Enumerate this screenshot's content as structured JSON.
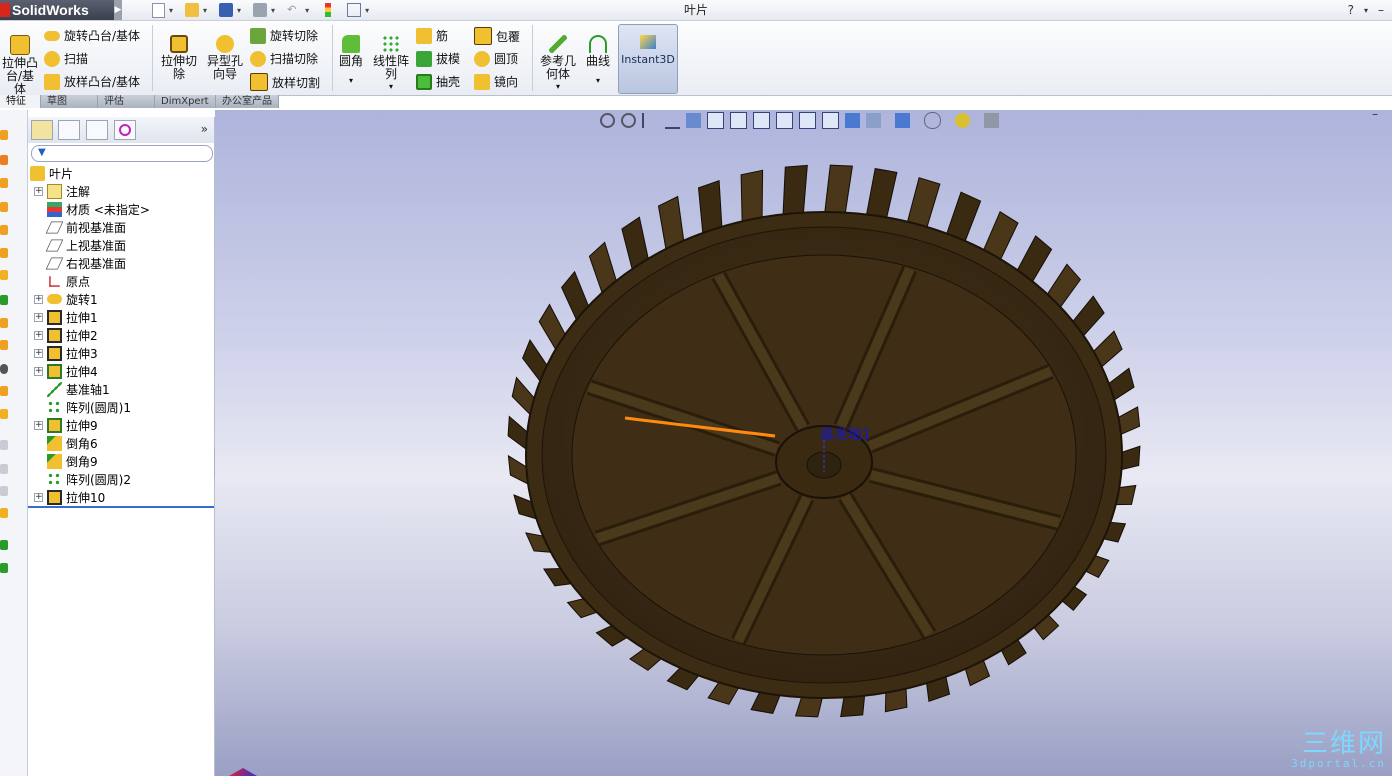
{
  "app": {
    "brand": "SolidWorks",
    "title": "叶片",
    "help": "?",
    "minimize": "–"
  },
  "ribbon": {
    "cmd_extrude_boss": "拉伸凸台/基体",
    "cmd_revolve_boss": "旋转凸台/基体",
    "cmd_sweep": "扫描",
    "cmd_loft_boss": "放样凸台/基体",
    "cmd_extrude_cut": "拉伸切除",
    "cmd_hole_wizard": "异型孔向导",
    "cmd_revolve_cut": "旋转切除",
    "cmd_sweep_cut": "扫描切除",
    "cmd_loft_cut": "放样切割",
    "cmd_fillet": "圆角",
    "cmd_linear_pattern": "线性阵列",
    "cmd_rib": "筋",
    "cmd_draft": "拔模",
    "cmd_shell": "抽壳",
    "cmd_wrap": "包覆",
    "cmd_dome": "圆顶",
    "cmd_mirror": "镜向",
    "cmd_ref_geometry": "参考几何体",
    "cmd_curves": "曲线",
    "cmd_instant3d": "Instant3D"
  },
  "tabs": [
    "特征",
    "草图",
    "评估",
    "DimXpert",
    "办公室产品"
  ],
  "tree": {
    "root": "叶片",
    "items": [
      {
        "label": "注解",
        "exp": true,
        "icon": "annotation-icon"
      },
      {
        "label": "材质 <未指定>",
        "exp": false,
        "icon": "material-icon"
      },
      {
        "label": "前视基准面",
        "exp": false,
        "icon": "plane-icon"
      },
      {
        "label": "上视基准面",
        "exp": false,
        "icon": "plane-icon"
      },
      {
        "label": "右视基准面",
        "exp": false,
        "icon": "plane-icon"
      },
      {
        "label": "原点",
        "exp": false,
        "icon": "origin-icon"
      },
      {
        "label": "旋转1",
        "exp": true,
        "icon": "revolve-icon"
      },
      {
        "label": "拉伸1",
        "exp": true,
        "icon": "extrude-icon"
      },
      {
        "label": "拉伸2",
        "exp": true,
        "icon": "extrude-icon"
      },
      {
        "label": "拉伸3",
        "exp": true,
        "icon": "extrude-icon"
      },
      {
        "label": "拉伸4",
        "exp": true,
        "icon": "extrude-cut-icon"
      },
      {
        "label": "基准轴1",
        "exp": false,
        "icon": "axis-icon"
      },
      {
        "label": "阵列(圆周)1",
        "exp": false,
        "icon": "pattern-icon"
      },
      {
        "label": "拉伸9",
        "exp": true,
        "icon": "extrude-cut-icon"
      },
      {
        "label": "倒角6",
        "exp": false,
        "icon": "chamfer-icon"
      },
      {
        "label": "倒角9",
        "exp": false,
        "icon": "chamfer-icon"
      },
      {
        "label": "阵列(圆周)2",
        "exp": false,
        "icon": "pattern-icon"
      },
      {
        "label": "拉伸10",
        "exp": true,
        "icon": "extrude-icon"
      }
    ],
    "expand_symbol": "+",
    "collapse_panel": "»"
  },
  "viewport": {
    "axis_label": "基准轴1"
  },
  "watermark": {
    "line1": "三维网",
    "line2": "3dportal.cn"
  }
}
